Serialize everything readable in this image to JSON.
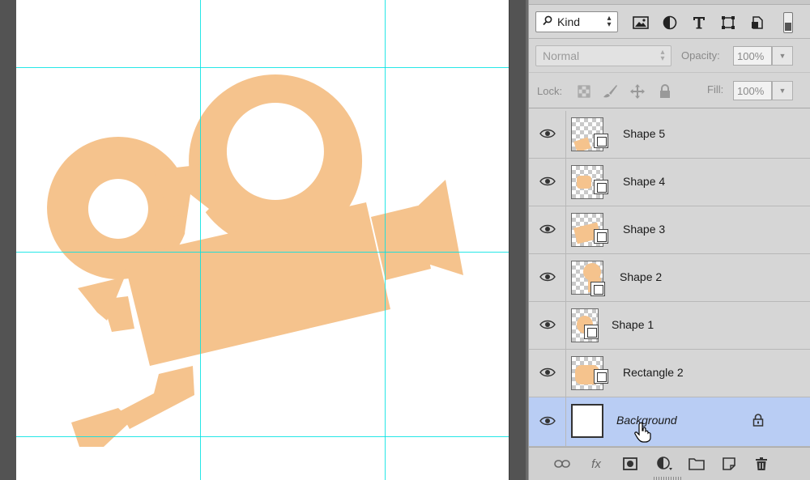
{
  "layers_panel": {
    "filter": {
      "kind_label": "Kind"
    },
    "blend_mode": {
      "value": "Normal"
    },
    "opacity": {
      "label": "Opacity:",
      "value": "100%"
    },
    "lock": {
      "label": "Lock:"
    },
    "fill": {
      "label": "Fill:",
      "value": "100%"
    },
    "layers": [
      {
        "name": "Shape 5",
        "visible": true,
        "type": "shape",
        "selected": false
      },
      {
        "name": "Shape 4",
        "visible": true,
        "type": "shape",
        "selected": false
      },
      {
        "name": "Shape 3",
        "visible": true,
        "type": "shape",
        "selected": false
      },
      {
        "name": "Shape 2",
        "visible": true,
        "type": "shape",
        "selected": false
      },
      {
        "name": "Shape 1",
        "visible": true,
        "type": "shape",
        "selected": false
      },
      {
        "name": "Rectangle 2",
        "visible": true,
        "type": "shape",
        "selected": false
      },
      {
        "name": "Background",
        "visible": true,
        "type": "background",
        "selected": true,
        "locked": true
      }
    ],
    "bottom_icons": [
      "link-icon",
      "fx-icon",
      "mask-icon",
      "adjustment-icon",
      "folder-icon",
      "new-layer-icon",
      "trash-icon"
    ]
  },
  "canvas": {
    "shape_color": "#f5c38d",
    "guide_color": "#00e3e3",
    "background_color": "#ffffff"
  }
}
